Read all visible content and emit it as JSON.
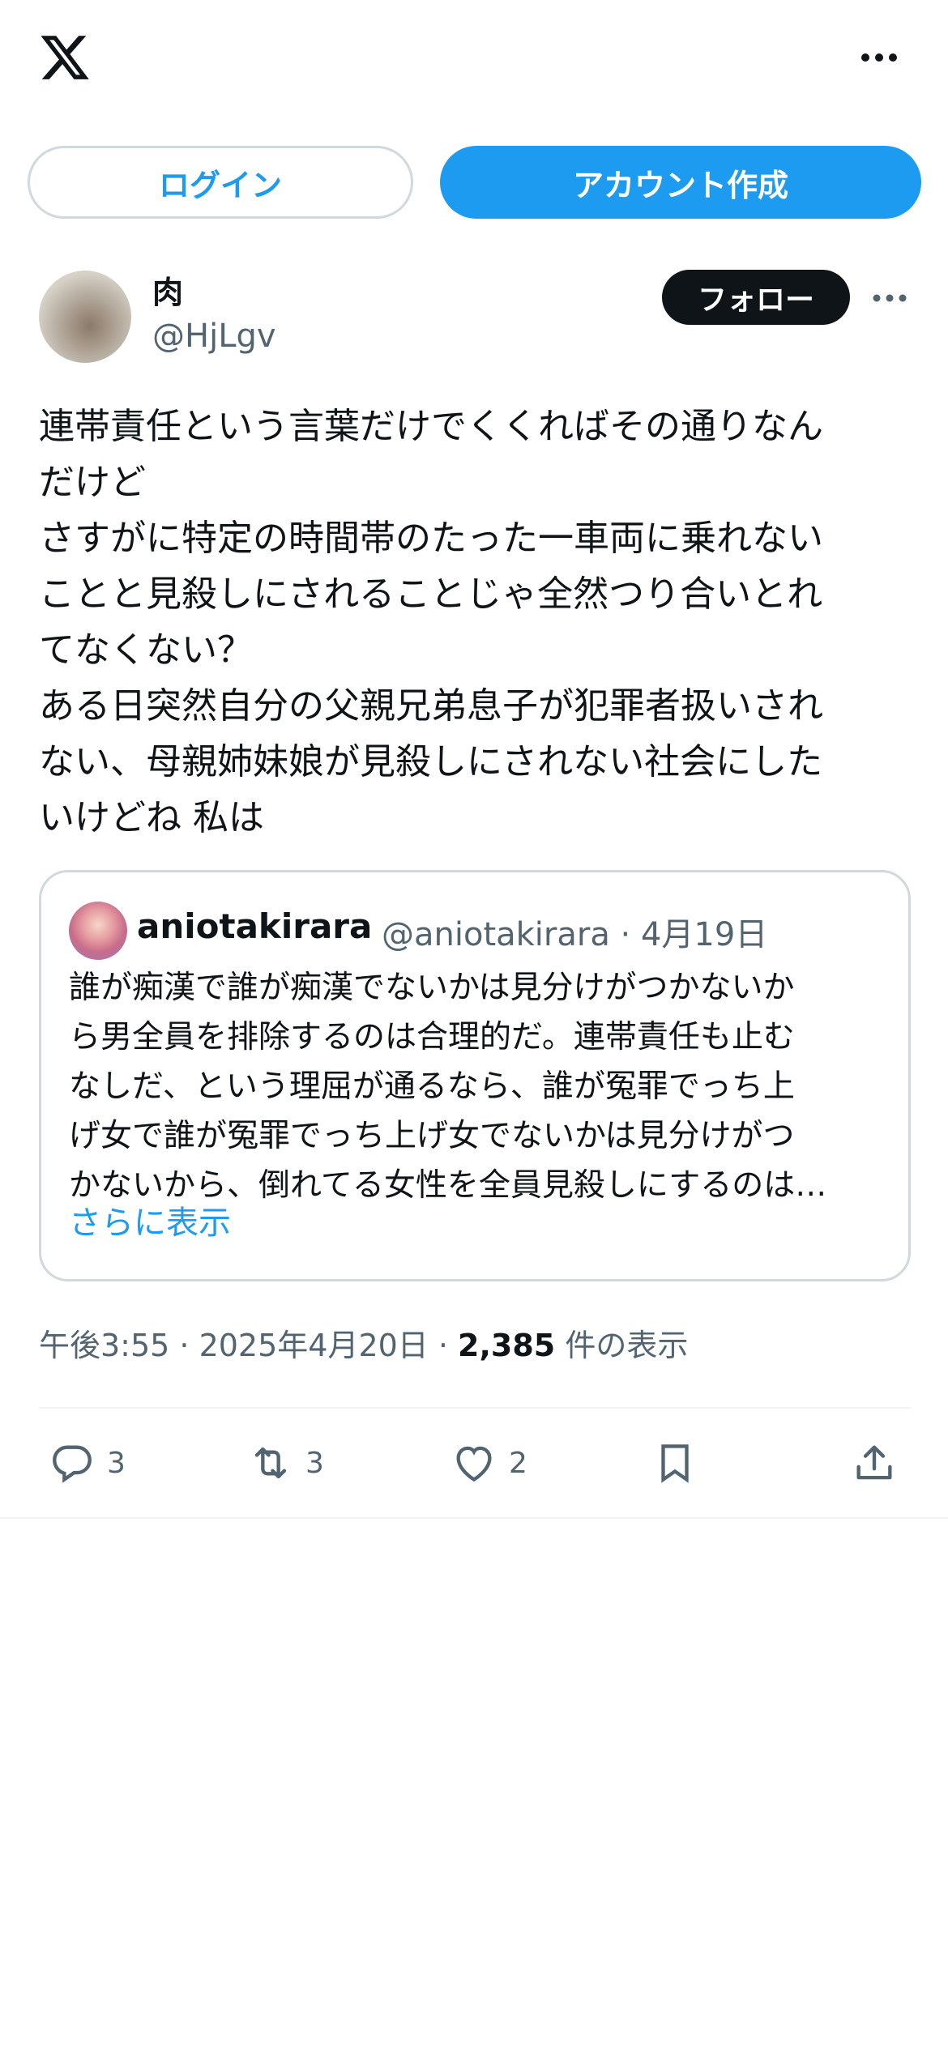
{
  "header": {
    "logo_icon": "x-logo-icon",
    "menu_icon": "more-horizontal-icon"
  },
  "auth": {
    "login_label": "ログイン",
    "signup_label": "アカウント作成"
  },
  "post": {
    "author_name": "肉",
    "author_handle": "@HjLgv",
    "follow_label": "フォロー",
    "text": "連帯責任という言葉だけでくくればその通りなん\nだけど\nさすがに特定の時間帯のたった一車両に乗れない\nことと見殺しにされることじゃ全然つり合いとれ\nてなくない？\nある日突然自分の父親兄弟息子が犯罪者扱いされ\nない、母親姉妹娘が見殺しにされない社会にした\nいけどね 私は",
    "timestamp": "午後3:55 · 2025年4月20日 · ",
    "views_count": "2,385",
    "views_label": " 件の表示"
  },
  "quote": {
    "name": "aniotakirara",
    "meta": "@aniotakirara · 4月19日",
    "text": "誰が痴漢で誰が痴漢でないかは見分けがつかないか\nら男全員を排除するのは合理的だ。連帯責任も止む\nなしだ、という理屈が通るなら、誰が冤罪でっち上\nげ女で誰が冤罪でっち上げ女でないかは見分けがつ\nかないから、倒れてる女性を全員見殺しにするのは…",
    "show_more": "さらに表示"
  },
  "actions": {
    "reply_count": "3",
    "retweet_count": "3",
    "like_count": "2"
  },
  "colors": {
    "accent": "#1d9bf0",
    "text": "#0f1419",
    "secondary": "#536471",
    "border": "#cfd9de"
  }
}
